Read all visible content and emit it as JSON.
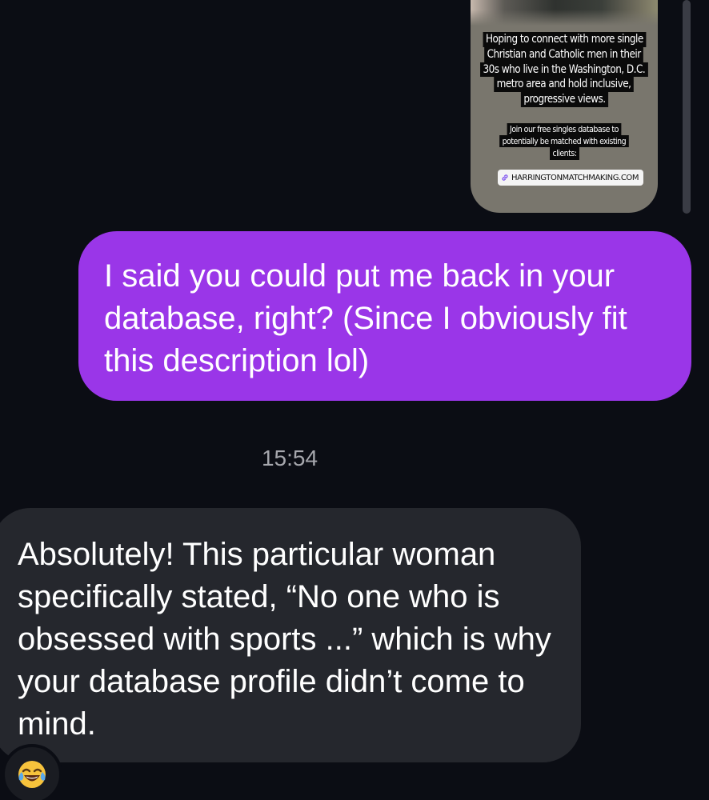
{
  "story_preview": {
    "headline_lines": [
      "Hoping to connect with more single",
      "Christian and Catholic men in their",
      "30s who live in the Washington, D.C.",
      "metro area and hold inclusive,",
      "progressive views."
    ],
    "subline_lines": [
      "Join our free singles database to",
      "potentially be matched with existing",
      "clients:"
    ],
    "link_label": "HARRINGTONMATCHMAKING.COM",
    "link_icon": "link-icon"
  },
  "messages": {
    "sent": {
      "text": "I said you could put me back in your database, right? (Since I obviously fit this description lol)"
    },
    "timestamp": "15:54",
    "received": {
      "text": "Absolutely! This particular woman specifically stated, “No one who is obsessed with sports ...” which is why your database profile didn’t come to mind."
    },
    "reaction": {
      "emoji": "😂",
      "icon": "face-with-tears-of-joy-icon"
    }
  },
  "colors": {
    "background": "#0b0d14",
    "sent_bubble": "#9a36e8",
    "received_bubble": "#25272d",
    "timestamp": "#a6a7ad"
  }
}
